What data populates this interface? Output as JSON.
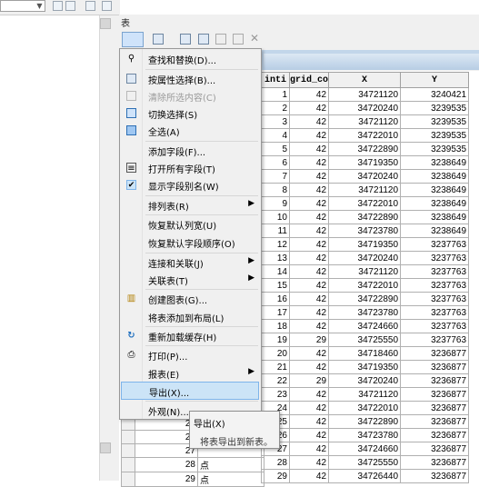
{
  "table_window": {
    "title": "表"
  },
  "context_menu": {
    "items": [
      {
        "label": "查找和替换(D)...",
        "icon": "binoculars-icon",
        "enabled": true,
        "submenu": false
      },
      {
        "label": "按属性选择(B)...",
        "icon": "select-by-attribute-icon",
        "enabled": true,
        "submenu": false
      },
      {
        "label": "清除所选内容(C)",
        "icon": "clear-selection-icon",
        "enabled": false,
        "submenu": false
      },
      {
        "label": "切换选择(S)",
        "icon": "switch-selection-icon",
        "enabled": true,
        "submenu": false
      },
      {
        "label": "全选(A)",
        "icon": "select-all-icon",
        "enabled": true,
        "submenu": false
      },
      {
        "label": "添加字段(F)...",
        "icon": "",
        "enabled": true,
        "submenu": false
      },
      {
        "label": "打开所有字段(T)",
        "icon": "fields-icon",
        "enabled": true,
        "submenu": false
      },
      {
        "label": "显示字段别名(W)",
        "icon": "checkmark-icon",
        "enabled": true,
        "submenu": false
      },
      {
        "label": "排列表(R)",
        "icon": "",
        "enabled": true,
        "submenu": true
      },
      {
        "label": "恢复默认列宽(U)",
        "icon": "",
        "enabled": true,
        "submenu": false
      },
      {
        "label": "恢复默认字段顺序(O)",
        "icon": "",
        "enabled": true,
        "submenu": false
      },
      {
        "label": "连接和关联(J)",
        "icon": "",
        "enabled": true,
        "submenu": true
      },
      {
        "label": "关联表(T)",
        "icon": "",
        "enabled": true,
        "submenu": true
      },
      {
        "label": "创建图表(G)...",
        "icon": "chart-icon",
        "enabled": true,
        "submenu": false
      },
      {
        "label": "将表添加到布局(L)",
        "icon": "",
        "enabled": true,
        "submenu": false
      },
      {
        "label": "重新加载缓存(H)",
        "icon": "reload-icon",
        "enabled": true,
        "submenu": false
      },
      {
        "label": "打印(P)...",
        "icon": "printer-icon",
        "enabled": true,
        "submenu": false
      },
      {
        "label": "报表(E)",
        "icon": "",
        "enabled": true,
        "submenu": true
      },
      {
        "label": "导出(X)...",
        "icon": "",
        "enabled": true,
        "submenu": false,
        "highlighted": true
      },
      {
        "label": "外观(N)...",
        "icon": "",
        "enabled": true,
        "submenu": false
      }
    ]
  },
  "tooltip": {
    "title": "导出(X)",
    "description": "将表导出到新表。"
  },
  "table": {
    "columns": [
      "inti",
      "grid_co",
      "X",
      "Y"
    ],
    "rows": [
      [
        "1",
        "42",
        "34721120",
        "3240421"
      ],
      [
        "2",
        "42",
        "34720240",
        "3239535"
      ],
      [
        "3",
        "42",
        "34721120",
        "3239535"
      ],
      [
        "4",
        "42",
        "34722010",
        "3239535"
      ],
      [
        "5",
        "42",
        "34722890",
        "3239535"
      ],
      [
        "6",
        "42",
        "34719350",
        "3238649"
      ],
      [
        "7",
        "42",
        "34720240",
        "3238649"
      ],
      [
        "8",
        "42",
        "34721120",
        "3238649"
      ],
      [
        "9",
        "42",
        "34722010",
        "3238649"
      ],
      [
        "10",
        "42",
        "34722890",
        "3238649"
      ],
      [
        "11",
        "42",
        "34723780",
        "3238649"
      ],
      [
        "12",
        "42",
        "34719350",
        "3237763"
      ],
      [
        "13",
        "42",
        "34720240",
        "3237763"
      ],
      [
        "14",
        "42",
        "34721120",
        "3237763"
      ],
      [
        "15",
        "42",
        "34722010",
        "3237763"
      ],
      [
        "16",
        "42",
        "34722890",
        "3237763"
      ],
      [
        "17",
        "42",
        "34723780",
        "3237763"
      ],
      [
        "18",
        "42",
        "34724660",
        "3237763"
      ],
      [
        "19",
        "29",
        "34725550",
        "3237763"
      ],
      [
        "20",
        "42",
        "34718460",
        "3236877"
      ],
      [
        "21",
        "42",
        "34719350",
        "3236877"
      ],
      [
        "22",
        "29",
        "34720240",
        "3236877"
      ],
      [
        "23",
        "42",
        "34721120",
        "3236877"
      ],
      [
        "24",
        "42",
        "34722010",
        "3236877"
      ],
      [
        "25",
        "42",
        "34722890",
        "3236877"
      ],
      [
        "26",
        "42",
        "34723780",
        "3236877"
      ],
      [
        "27",
        "42",
        "34724660",
        "3236877"
      ],
      [
        "28",
        "42",
        "34725550",
        "3236877"
      ],
      [
        "29",
        "42",
        "34726440",
        "3236877"
      ]
    ],
    "left_rows": [
      {
        "fid": "25",
        "shape": ""
      },
      {
        "fid": "26",
        "shape": ""
      },
      {
        "fid": "27",
        "shape": ""
      },
      {
        "fid": "28",
        "shape": "点"
      },
      {
        "fid": "29",
        "shape": "点"
      }
    ]
  }
}
